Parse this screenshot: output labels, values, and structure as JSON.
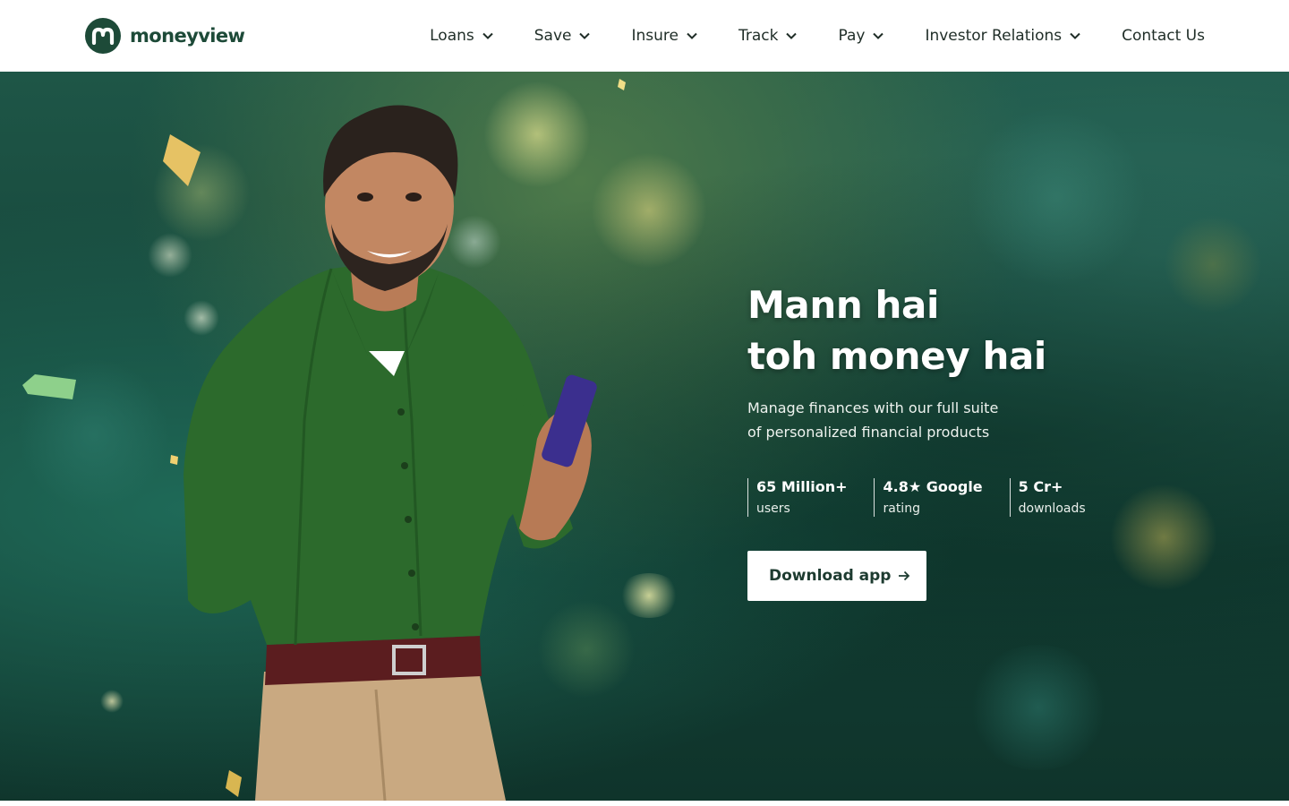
{
  "header": {
    "logo_text": "moneyview",
    "nav": [
      {
        "label": "Loans",
        "has_dropdown": true
      },
      {
        "label": "Save",
        "has_dropdown": true
      },
      {
        "label": "Insure",
        "has_dropdown": true
      },
      {
        "label": "Track",
        "has_dropdown": true
      },
      {
        "label": "Pay",
        "has_dropdown": true
      },
      {
        "label": "Investor Relations",
        "has_dropdown": true
      },
      {
        "label": "Contact Us",
        "has_dropdown": false
      }
    ]
  },
  "hero": {
    "title_line1": "Mann hai",
    "title_line2": "toh money hai",
    "subtitle": "Manage finances with our full suite of personalized financial products",
    "stats": [
      {
        "value": "65 Million+",
        "label": "users"
      },
      {
        "value": "4.8★ Google",
        "label": "rating"
      },
      {
        "value": "5 Cr+",
        "label": "downloads"
      }
    ],
    "cta_label": "Download app",
    "image": "man-in-green-shirt-holding-phone"
  },
  "icons": {
    "dropdown": "chevron-down-icon",
    "cta": "arrow-right-icon"
  },
  "colors": {
    "brand_green": "#1d4a38",
    "hero_background": "#1e5647",
    "cta_background": "#ffffff",
    "cta_text": "#1d3b30"
  }
}
